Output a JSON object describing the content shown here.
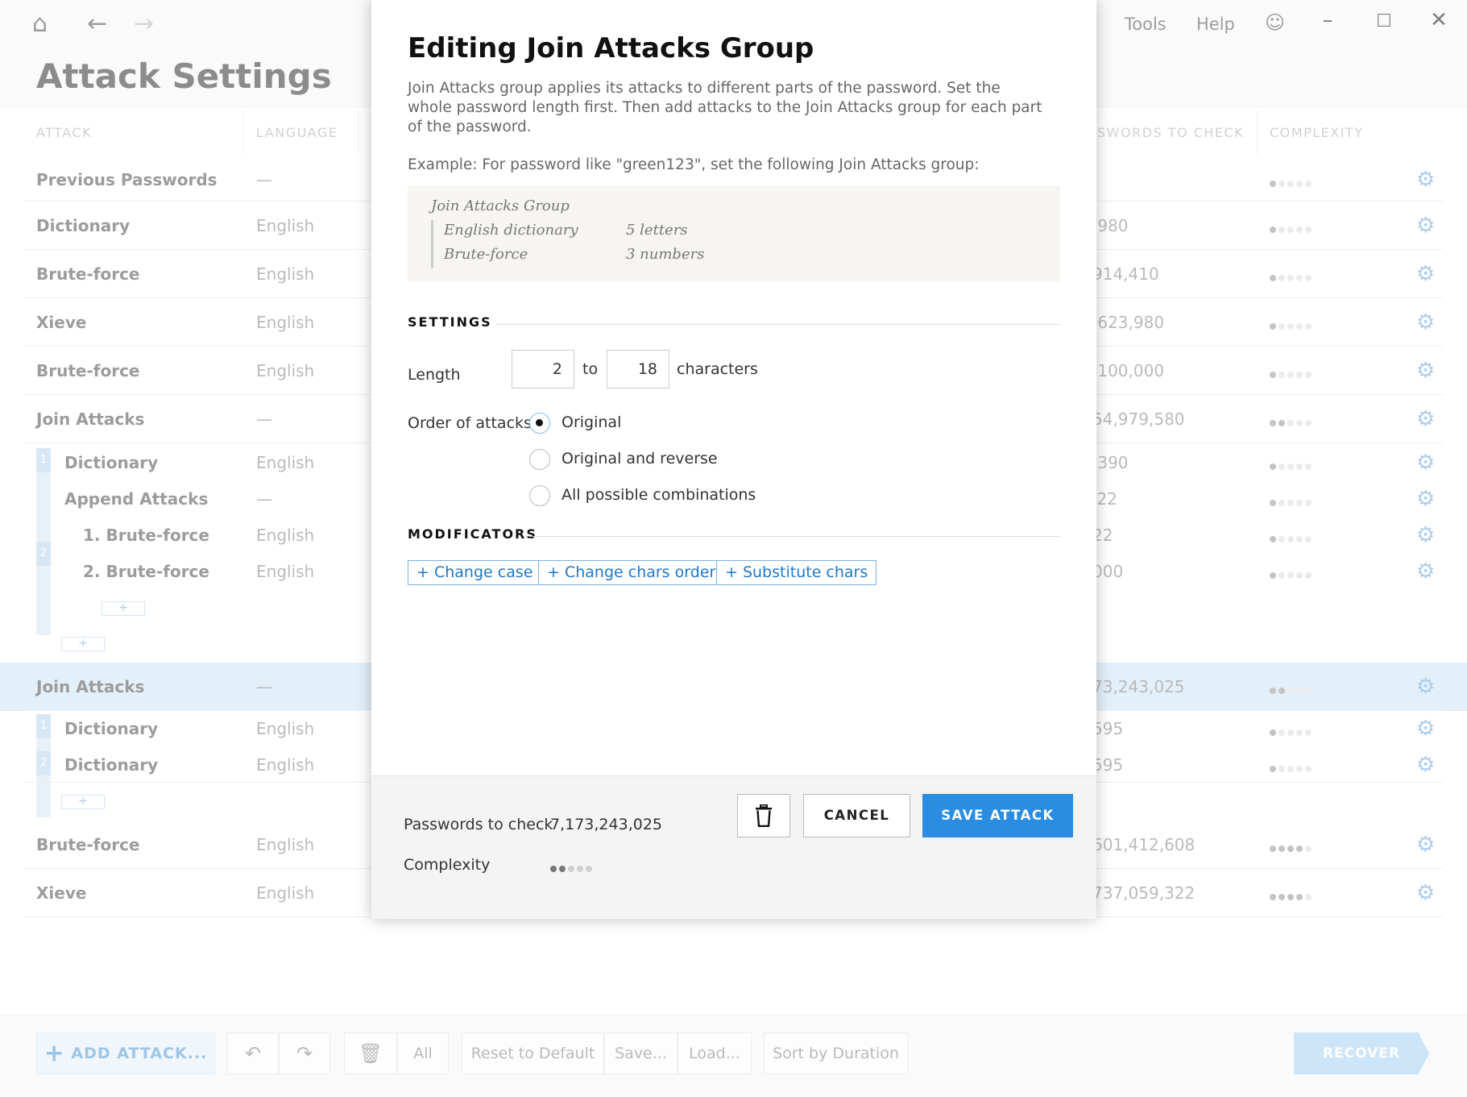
{
  "app": {
    "title": "Attack Settings",
    "menu": {
      "tools": "Tools",
      "help": "Help"
    },
    "icons": {
      "home": "home-icon",
      "back": "arrow-left-icon",
      "forward": "arrow-right-icon",
      "feedback": "smiley-icon",
      "settings": "gear-icon"
    },
    "columns": {
      "attack": "ATTACK",
      "language": "LANGUAGE",
      "passwords": "SWORDS TO CHECK",
      "complexity": "COMPLEXITY"
    },
    "rows": [
      {
        "name": "Previous Passwords",
        "language": "—",
        "passwords": "",
        "complexity": 1
      },
      {
        "name": "Dictionary",
        "language": "English",
        "passwords": ",980",
        "complexity": 1
      },
      {
        "name": "Brute-force",
        "language": "English",
        "passwords": "914,410",
        "complexity": 1
      },
      {
        "name": "Xieve",
        "language": "English",
        "passwords": ",623,980",
        "complexity": 1
      },
      {
        "name": "Brute-force",
        "language": "English",
        "passwords": ",100,000",
        "complexity": 1
      },
      {
        "name": "Join Attacks",
        "language": "—",
        "passwords": "54,979,580",
        "complexity": 2
      },
      {
        "name": "Dictionary",
        "language": "English",
        "passwords": ",390",
        "complexity": 1
      },
      {
        "name": "Append Attacks",
        "language": "—",
        "passwords": "'22",
        "complexity": 1
      },
      {
        "name": "1. Brute-force",
        "language": "English",
        "passwords": "22",
        "complexity": 1
      },
      {
        "name": "2. Brute-force",
        "language": "English",
        "passwords": "000",
        "complexity": 1
      },
      {
        "name": "Join Attacks",
        "language": "—",
        "passwords": "73,243,025",
        "complexity": 2
      },
      {
        "name": "Dictionary",
        "language": "English",
        "passwords": "595",
        "complexity": 1
      },
      {
        "name": "Dictionary",
        "language": "English",
        "passwords": "595",
        "complexity": 1
      },
      {
        "name": "Brute-force",
        "language": "English",
        "passwords": "601,412,608",
        "complexity": 4
      },
      {
        "name": "Xieve",
        "language": "English",
        "passwords": "737,059,322",
        "complexity": 4
      }
    ],
    "group_numbers": {
      "g1a": "1",
      "g1b": "2",
      "g2a": "1",
      "g2b": "2"
    },
    "plus_label": "+",
    "toolbar": {
      "add_attack": "ADD ATTACK...",
      "all": "All",
      "reset": "Reset to Default",
      "save": "Save...",
      "load": "Load...",
      "sort": "Sort by Duration",
      "recover": "RECOVER"
    }
  },
  "dialog": {
    "title": "Editing Join Attacks Group",
    "description": "Join Attacks group applies its attacks to different parts of the password. Set the whole password length first. Then add attacks to the Join Attacks group for each part of the password.",
    "example_intro": "Example: For password like \"green123\", set the following Join Attacks group:",
    "example": {
      "group_label": "Join Attacks Group",
      "items": [
        {
          "attack": "English dictionary",
          "detail": "5 letters"
        },
        {
          "attack": "Brute-force",
          "detail": "3 numbers"
        }
      ]
    },
    "settings_title": "SETTINGS",
    "length": {
      "label": "Length",
      "from": "2",
      "to_label": "to",
      "to": "18",
      "unit": "characters"
    },
    "order": {
      "label": "Order of attacks:",
      "options": [
        "Original",
        "Original and reverse",
        "All possible combinations"
      ],
      "selected": "Original"
    },
    "modificators_title": "MODIFICATORS",
    "modificators": [
      "+ Change case",
      "+ Change chars order",
      "+ Substitute chars"
    ],
    "footer": {
      "passwords_label": "Passwords to check",
      "passwords_value": "7,173,243,025",
      "complexity_label": "Complexity",
      "complexity_level": 2,
      "cancel": "CANCEL",
      "save": "SAVE ATTACK"
    }
  }
}
